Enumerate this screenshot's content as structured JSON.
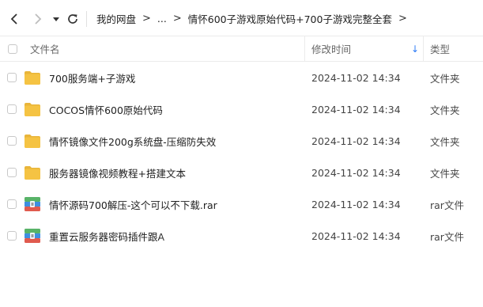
{
  "breadcrumb": {
    "root": "我的网盘",
    "ellipsis": "...",
    "current": "情怀600子游戏原始代码+700子游戏完整全套"
  },
  "columns": {
    "name": "文件名",
    "modified": "修改时间",
    "type": "类型",
    "sort_indicator": "↓"
  },
  "files": [
    {
      "name": "700服务端+子游戏",
      "modified": "2024-11-02 14:34",
      "type": "文件夹",
      "icon": "folder-icon"
    },
    {
      "name": "COCOS情怀600原始代码",
      "modified": "2024-11-02 14:34",
      "type": "文件夹",
      "icon": "folder-icon"
    },
    {
      "name": "情怀镜像文件200g系统盘-压缩防失效",
      "modified": "2024-11-02 14:34",
      "type": "文件夹",
      "icon": "folder-icon"
    },
    {
      "name": "服务器镜像视频教程+搭建文本",
      "modified": "2024-11-02 14:34",
      "type": "文件夹",
      "icon": "folder-icon"
    },
    {
      "name": "情怀源码700解压-这个可以不下载.rar",
      "modified": "2024-11-02 14:34",
      "type": "rar文件",
      "icon": "rar-archive-icon"
    },
    {
      "name": "重置云服务器密码插件跟A",
      "modified": "2024-11-02 14:34",
      "type": "rar文件",
      "icon": "rar-archive-icon"
    }
  ],
  "colors": {
    "folder": "#F5C343",
    "folder_tab": "#E9B53A",
    "accent": "#2F7CF6",
    "rar_green": "#58B368",
    "rar_blue": "#3E8FE0",
    "rar_red": "#E05A4E"
  }
}
